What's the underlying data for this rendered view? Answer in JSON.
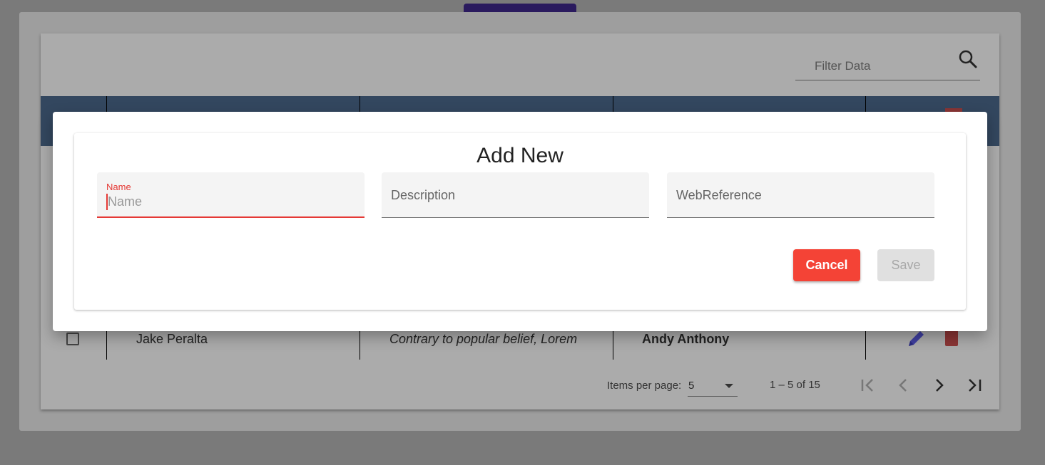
{
  "toolbar": {
    "filter_placeholder": "Filter Data",
    "search_icon": "search-icon"
  },
  "table": {
    "row": {
      "name": "Jake Peralta",
      "description": "Contrary to popular belief, Lorem",
      "author": "Andy Anthony",
      "checked": false
    }
  },
  "paginator": {
    "items_per_page_label": "Items per page:",
    "page_size": "5",
    "range_label": "1 – 5 of 15"
  },
  "dialog": {
    "title": "Add New",
    "fields": {
      "name_label": "Name",
      "name_placeholder": "Name",
      "name_value": "",
      "description_placeholder": "Description",
      "webreference_placeholder": "WebReference"
    },
    "cancel_label": "Cancel",
    "save_label": "Save"
  },
  "colors": {
    "header": "#33475f",
    "accent_error": "#f44336",
    "top_tab": "#2a1a5e"
  }
}
